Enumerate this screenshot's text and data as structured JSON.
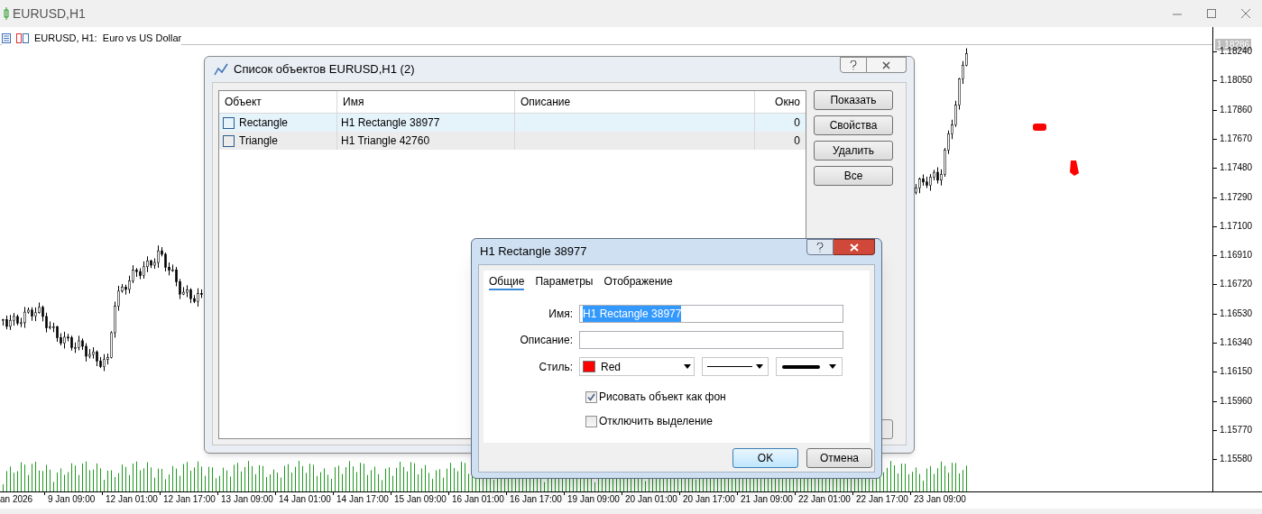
{
  "window": {
    "title": "EURUSD,H1"
  },
  "chart": {
    "header": "EURUSD, H1:  Euro vs US Dollar",
    "current_price": "1.18286",
    "price_labels": [
      "1.18240",
      "1.18050",
      "1.17860",
      "1.17670",
      "1.17480",
      "1.17290",
      "1.17100",
      "1.16910",
      "1.16720",
      "1.16530",
      "1.16340",
      "1.16150",
      "1.15960",
      "1.15770",
      "1.15580"
    ],
    "time_labels": [
      "an 2026",
      "9 Jan 09:00",
      "12 Jan 01:00",
      "12 Jan 17:00",
      "13 Jan 09:00",
      "14 Jan 01:00",
      "14 Jan 17:00",
      "15 Jan 09:00",
      "16 Jan 01:00",
      "16 Jan 17:00",
      "19 Jan 09:00",
      "20 Jan 01:00",
      "20 Jan 17:00",
      "21 Jan 09:00",
      "22 Jan 01:00",
      "22 Jan 17:00",
      "23 Jan 09:00"
    ]
  },
  "object_list_dialog": {
    "title": "Список объектов EURUSD,H1 (2)",
    "columns": [
      "Объект",
      "Имя",
      "Описание",
      "Окно"
    ],
    "rows": [
      {
        "object": "Rectangle",
        "name": "H1 Rectangle 38977",
        "window": "0",
        "selected": true
      },
      {
        "object": "Triangle",
        "name": "H1 Triangle 42760",
        "window": "0",
        "selected": false
      }
    ],
    "buttons": [
      "Показать",
      "Свойства",
      "Удалить",
      "Все"
    ]
  },
  "properties_dialog": {
    "title": "H1 Rectangle 38977",
    "tabs": [
      {
        "label": "Общие",
        "selected": true
      },
      {
        "label": "Параметры",
        "selected": false
      },
      {
        "label": "Отображение",
        "selected": false
      }
    ],
    "fields": [
      {
        "label": "Имя:",
        "value": "H1 Rectangle 38977",
        "text_selected": true
      },
      {
        "label": "Описание:"
      }
    ],
    "style": {
      "label": "Стиль:",
      "color_name": "Red",
      "color": "#ff0000"
    },
    "checkboxes": [
      {
        "label": "Рисовать объект как фон",
        "checked": true
      },
      {
        "label": "Отключить выделение",
        "checked": false
      }
    ],
    "buttons": [
      {
        "label": "OK",
        "default": true
      },
      {
        "label": "Отмена",
        "default": false
      }
    ]
  }
}
